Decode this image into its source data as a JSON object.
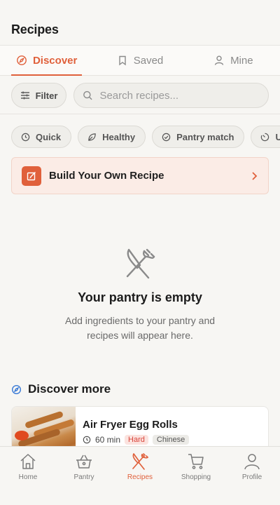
{
  "header": {
    "title": "Recipes"
  },
  "tabs": [
    {
      "label": "Discover",
      "icon": "compass-icon",
      "active": true
    },
    {
      "label": "Saved",
      "icon": "bookmark-icon",
      "active": false
    },
    {
      "label": "Mine",
      "icon": "user-icon",
      "active": false
    }
  ],
  "search": {
    "filter_label": "Filter",
    "placeholder": "Search recipes..."
  },
  "chips": [
    {
      "label": "Quick",
      "icon": "clock-icon"
    },
    {
      "label": "Healthy",
      "icon": "leaf-icon"
    },
    {
      "label": "Pantry match",
      "icon": "check-circle-icon"
    },
    {
      "label": "U",
      "icon": "timer-icon"
    }
  ],
  "build_card": {
    "label": "Build Your Own Recipe"
  },
  "empty_state": {
    "title": "Your pantry is empty",
    "description": "Add ingredients to your pantry and recipes will appear here."
  },
  "discover": {
    "title": "Discover more",
    "recipes": [
      {
        "name": "Air Fryer Egg Rolls",
        "time": "60 min",
        "difficulty": "Hard",
        "cuisine": "Chinese"
      }
    ]
  },
  "bottom_nav": [
    {
      "label": "Home",
      "icon": "home-icon",
      "active": false
    },
    {
      "label": "Pantry",
      "icon": "basket-icon",
      "active": false
    },
    {
      "label": "Recipes",
      "icon": "utensils-icon",
      "active": true
    },
    {
      "label": "Shopping",
      "icon": "cart-icon",
      "active": false
    },
    {
      "label": "Profile",
      "icon": "profile-icon",
      "active": false
    }
  ],
  "colors": {
    "accent": "#e0603b",
    "background": "#f7f6f3",
    "build_card_bg": "#fbece6"
  }
}
